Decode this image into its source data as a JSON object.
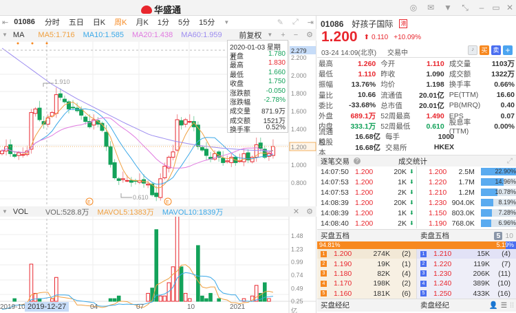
{
  "app": {
    "title": "华盛通"
  },
  "toolbar": {
    "code": "01086",
    "tabs": [
      "分时",
      "五日",
      "日K",
      "周K",
      "月K",
      "1分",
      "5分",
      "15分"
    ],
    "active": "周K"
  },
  "ma": {
    "label": "MA",
    "ma5": "MA5:1.716",
    "ma10": "MA10:1.585",
    "ma20": "MA20:1.438",
    "ma60": "MA60:1.959",
    "adjust": "前复权"
  },
  "colors": {
    "ma5": "#f0a040",
    "ma10": "#3aa8e8",
    "ma20": "#e07ae0",
    "ma60": "#9c8cf0",
    "up": "#e8262d",
    "down": "#13a25a"
  },
  "chart_data": {
    "type": "candlestick",
    "price_ticks": [
      "2.200",
      "2.000",
      "1.800",
      "1.600",
      "1.400",
      "1.200",
      "1.000",
      "0.800"
    ],
    "crosshair_price": "2.279",
    "last_price_label": "1.200",
    "high_label": "1.910",
    "low_label": "0.610",
    "closes": [
      1.15,
      1.2,
      1.12,
      1.09,
      1.13,
      1.11,
      1.15,
      1.58,
      1.62,
      1.5,
      1.45,
      1.52,
      1.58,
      1.78,
      1.75,
      1.7,
      1.62,
      1.64,
      1.6,
      1.55,
      1.48,
      1.42,
      1.5,
      1.45,
      1.38,
      1.2,
      1.0,
      0.85,
      0.82,
      0.84,
      0.82,
      0.8,
      0.81,
      0.82,
      0.79,
      0.78,
      0.66,
      0.64,
      0.84,
      0.98,
      1.08,
      1.14,
      1.5,
      1.44,
      1.5,
      1.48,
      1.42,
      1.2,
      1.16,
      1.1,
      1.06,
      1.12,
      1.08,
      1.02,
      1.04,
      1.08,
      1.02,
      1.04,
      1.12,
      1.05,
      1.08,
      1.22,
      1.18,
      1.08,
      1.12,
      1.2
    ],
    "ma60_anchors": [
      2.3,
      2.1,
      1.9,
      1.74,
      1.6,
      1.46,
      1.33,
      1.26,
      1.21,
      1.18,
      1.16,
      1.15
    ],
    "volumes": [
      0.1,
      0.12,
      0.18,
      0.3,
      0.2,
      0.15,
      0.25,
      0.95,
      0.4,
      0.3,
      0.2,
      0.25,
      0.3,
      0.7,
      0.2,
      0.15,
      0.18,
      0.25,
      0.12,
      0.2,
      0.1,
      0.15,
      0.2,
      0.1,
      0.12,
      0.18,
      0.3,
      0.3,
      0.35,
      0.12,
      0.15,
      0.1,
      0.18,
      0.15,
      0.12,
      0.4,
      0.5,
      1.6,
      0.35,
      0.35,
      0.6,
      0.9,
      1.9,
      0.9,
      0.4,
      0.3,
      0.25,
      1.3,
      0.35,
      0.3,
      0.4,
      0.25,
      0.3,
      0.2,
      0.22,
      0.15,
      0.25,
      0.2,
      0.3,
      0.25,
      0.35,
      0.55,
      0.4,
      0.6,
      0.3,
      0.25
    ],
    "vol_ticks": [
      "1.48",
      "1.23",
      "0.99",
      "0.74",
      "0.49",
      "0.25",
      "亿"
    ],
    "date_labels": [
      "2019-10",
      "2019-12-27",
      "04",
      "07",
      "10",
      "2021"
    ]
  },
  "tooltip": {
    "date": "2020-01-03 星期五",
    "rows": [
      {
        "k": "开盘",
        "v": "1.780",
        "c": "green"
      },
      {
        "k": "最高",
        "v": "1.830",
        "c": "red"
      },
      {
        "k": "最低",
        "v": "1.660",
        "c": "green"
      },
      {
        "k": "收盘",
        "v": "1.750",
        "c": "green"
      },
      {
        "k": "涨跌额",
        "v": "-0.050",
        "c": "green"
      },
      {
        "k": "涨跌幅",
        "v": "-2.78%",
        "c": "green"
      },
      {
        "k": "成交量",
        "v": "871.9万",
        "c": ""
      },
      {
        "k": "成交额",
        "v": "1521万",
        "c": ""
      },
      {
        "k": "换手率",
        "v": "0.52%",
        "c": ""
      }
    ]
  },
  "vol": {
    "label": "VOL",
    "vol": "VOL:528.8万",
    "mavol5": "MAVOL5:1383万",
    "mavol10": "MAVOL10:1839万"
  },
  "quote": {
    "code": "01086",
    "name": "好孩子国际",
    "market": "港",
    "price": "1.200",
    "change": "0.110",
    "pct": "+10.09%",
    "time": "03-24  14:09(北京)",
    "status": "交易中",
    "buy": "买",
    "sell": "卖",
    "add": "+"
  },
  "stats": [
    [
      [
        "最高",
        "1.260",
        "red"
      ],
      [
        "今开",
        "1.110",
        "red"
      ],
      [
        "成交量",
        "1103万",
        ""
      ]
    ],
    [
      [
        "最低",
        "1.110",
        "red"
      ],
      [
        "昨收",
        "1.090",
        ""
      ],
      [
        "成交额",
        "1322万",
        ""
      ]
    ],
    [
      [
        "振幅",
        "13.76%",
        ""
      ],
      [
        "均价",
        "1.198",
        ""
      ],
      [
        "换手率",
        "0.66%",
        ""
      ]
    ],
    [
      [
        "量比",
        "10.66",
        ""
      ],
      [
        "流通值",
        "20.01亿",
        ""
      ],
      [
        "PE(TTM)",
        "16.60",
        ""
      ]
    ],
    [
      [
        "委比",
        "-33.68%",
        ""
      ],
      [
        "总市值",
        "20.01亿",
        ""
      ],
      [
        "PB(MRQ)",
        "0.40",
        ""
      ]
    ],
    [
      [
        "外盘",
        "689.1万",
        "red"
      ],
      [
        "52周最高",
        "1.490",
        "red"
      ],
      [
        "EPS",
        "0.07",
        ""
      ]
    ],
    [
      [
        "内盘",
        "333.1万",
        "green"
      ],
      [
        "52周最低",
        "0.610",
        "green"
      ],
      [
        "股息率(TTM)",
        "0.00%",
        ""
      ]
    ],
    [
      [
        "流通股",
        "16.68亿",
        ""
      ],
      [
        "每手",
        "1000",
        ""
      ]
    ],
    [
      [
        "总股本",
        "16.68亿",
        ""
      ],
      [
        "交易所",
        "HKEX",
        ""
      ]
    ]
  ],
  "trades": {
    "title": "逐笔交易",
    "rows": [
      [
        "14:07:50",
        "1.200",
        "20K"
      ],
      [
        "14:07:53",
        "1.200",
        "1K"
      ],
      [
        "14:07:53",
        "1.200",
        "2K"
      ],
      [
        "14:08:39",
        "1.200",
        "20K"
      ],
      [
        "14:08:39",
        "1.200",
        "1K"
      ],
      [
        "14:08:40",
        "1.200",
        "2K"
      ]
    ]
  },
  "volstats": {
    "title": "成交统计",
    "rows": [
      [
        "1.200",
        "2.5M",
        "22.90%",
        22.9
      ],
      [
        "1.220",
        "1.7M",
        "14.96%",
        14.96
      ],
      [
        "1.210",
        "1.2M",
        "10.78%",
        10.78
      ],
      [
        "1.230",
        "904.0K",
        "8.19%",
        8.19
      ],
      [
        "1.150",
        "803.0K",
        "7.28%",
        7.28
      ],
      [
        "1.190",
        "768.0K",
        "6.96%",
        6.96
      ]
    ]
  },
  "orderbook": {
    "bid_title": "买盘五档",
    "ask_title": "卖盘五档",
    "depth5": "5",
    "depth10": "10",
    "bid_pct": "94.81%",
    "ask_pct": "5.19%",
    "bid_ratio": 94.81,
    "bids": [
      [
        "1",
        "1.200",
        "274K",
        "(2)"
      ],
      [
        "2",
        "1.190",
        "19K",
        "(1)"
      ],
      [
        "3",
        "1.180",
        "82K",
        "(4)"
      ],
      [
        "4",
        "1.170",
        "198K",
        "(2)"
      ],
      [
        "5",
        "1.160",
        "181K",
        "(6)"
      ]
    ],
    "asks": [
      [
        "1",
        "1.210",
        "15K",
        "(4)"
      ],
      [
        "2",
        "1.220",
        "119K",
        "(7)"
      ],
      [
        "3",
        "1.230",
        "206K",
        "(11)"
      ],
      [
        "4",
        "1.240",
        "389K",
        "(10)"
      ],
      [
        "5",
        "1.250",
        "433K",
        "(16)"
      ]
    ]
  },
  "brokers": {
    "bid": "买盘经纪",
    "ask": "卖盘经纪"
  }
}
